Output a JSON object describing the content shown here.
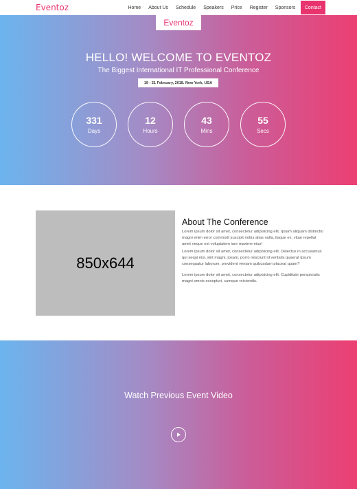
{
  "nav": {
    "brand": "Eventoz",
    "items": [
      "Home",
      "About Us",
      "Schedule",
      "Speakers",
      "Price",
      "Register",
      "Sponsors"
    ],
    "contact": "Contact"
  },
  "hero": {
    "logo": "Eventoz",
    "title": "HELLO! WELCOME TO EVENTOZ",
    "subtitle": "The Biggest International IT Professional Conference",
    "date": "19 - 21 February, 2018. New York, USA",
    "counters": [
      {
        "value": "331",
        "label": "Days"
      },
      {
        "value": "12",
        "label": "Hours"
      },
      {
        "value": "43",
        "label": "Mins"
      },
      {
        "value": "55",
        "label": "Secs"
      }
    ]
  },
  "about": {
    "image_text": "850x644",
    "heading": "About The Conference",
    "paragraphs": [
      "Lorem ipsum dolor sit amet, consectetur adipisicing elit. Ipsam aliquam distinctio magni enim error commodi suscipit nobis alias nulla, itaque ex, vitae repellat amet neque est voluptatem iure maxime eius!",
      "Lorem ipsum dolor sit amet, consectetur adipisicing elit. Delectus in accusamus qui sequi nisi, sint magni, ipsam, porro nesciunt id veritatis quaerat ipsum consequatur laborum, provident veniam quibusdam placeat quam?",
      "Lorem ipsum dolor sit amet, consectetur adipisicing elit. Cupiditate perspiciatis magni omnis excepturi, cumque reiciendis."
    ]
  },
  "video": {
    "heading": "Watch Previous Event Video",
    "play_icon": "play-icon"
  },
  "colors": {
    "accent": "#e8336e",
    "gradient_start": "#6cb4ee",
    "gradient_end": "#ec3f72"
  }
}
